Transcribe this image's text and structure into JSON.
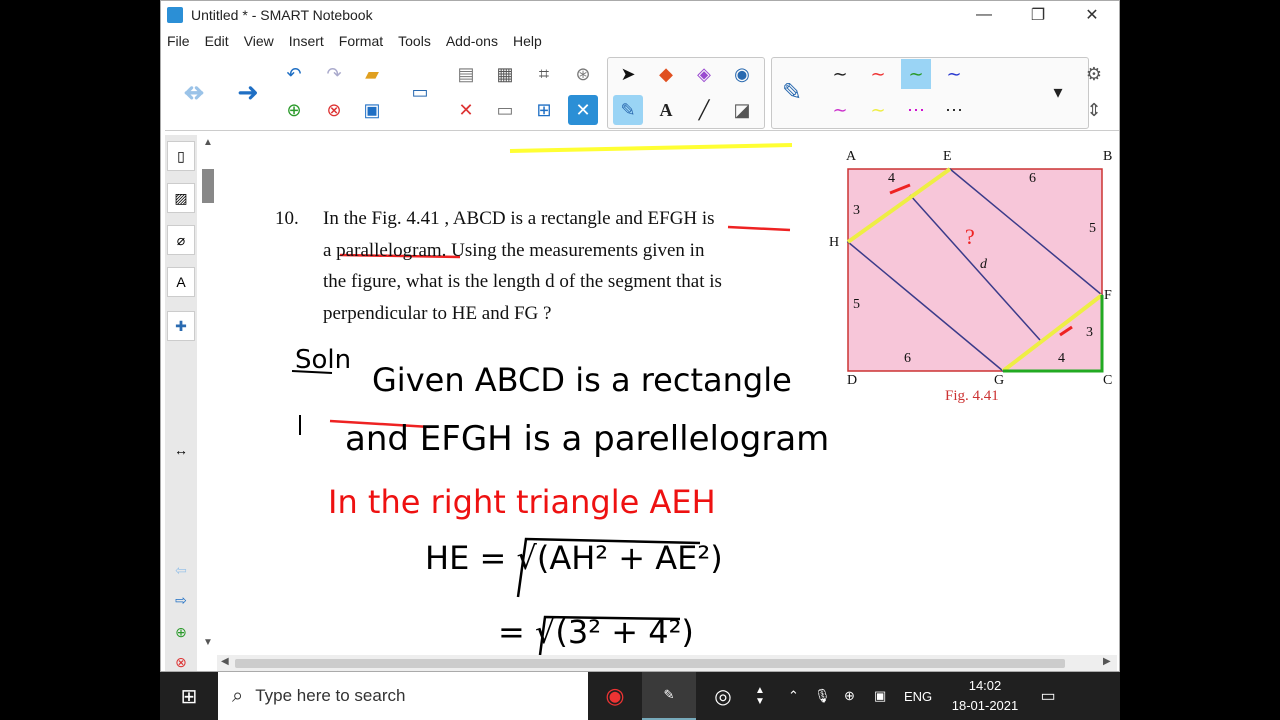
{
  "window": {
    "title": "Untitled * - SMART Notebook"
  },
  "menu": [
    "File",
    "Edit",
    "View",
    "Insert",
    "Format",
    "Tools",
    "Add-ons",
    "Help"
  ],
  "problem": {
    "number": "10.",
    "lines": [
      "In the Fig. 4.41 , ABCD is a rectangle and EFGH is",
      "a parallelogram. Using the measurements given in",
      "the figure, what is the length d of the segment that is",
      "perpendicular to HE and FG ?"
    ]
  },
  "figure": {
    "caption": "Fig. 4.41",
    "vertices": [
      "A",
      "E",
      "B",
      "H",
      "F",
      "D",
      "G",
      "C"
    ],
    "measurements": [
      "4",
      "6",
      "3",
      "5",
      "d",
      "5",
      "3",
      "6",
      "4",
      "?"
    ]
  },
  "handwriting": {
    "soln": "Soln",
    "line1": "Given ABCD is a rectangle",
    "line2": "and EFGH is a parellelogram",
    "line3": "In the right triangle AEH",
    "eq1": "HE = √(AH² + AE²)",
    "eq2": "= √(3² + 4²)"
  },
  "taskbar": {
    "search_placeholder": "Type here to search",
    "lang": "ENG",
    "time": "14:02",
    "date": "18-01-2021"
  }
}
